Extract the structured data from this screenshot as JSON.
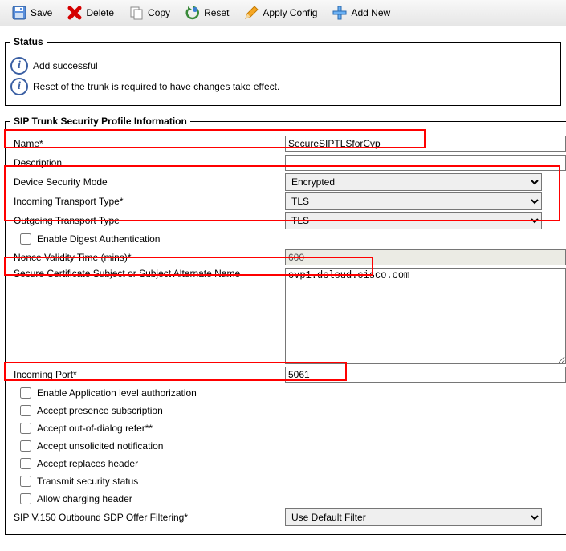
{
  "toolbar": {
    "save": "Save",
    "delete": "Delete",
    "copy": "Copy",
    "reset": "Reset",
    "apply": "Apply Config",
    "addnew": "Add New"
  },
  "status": {
    "legend": "Status",
    "line1": "Add successful",
    "line2": "Reset of the trunk is required to have changes take effect."
  },
  "profile": {
    "legend": "SIP Trunk Security Profile Information",
    "name_label": "Name*",
    "name_value": "SecureSIPTLSforCvp",
    "desc_label": "Description",
    "desc_value": "",
    "devmode_label": "Device Security Mode",
    "devmode_value": "Encrypted",
    "in_transport_label": "Incoming Transport Type*",
    "in_transport_value": "TLS",
    "out_transport_label": "Outgoing Transport Type",
    "out_transport_value": "TLS",
    "digest_label": "Enable Digest Authentication",
    "nonce_label": "Nonce Validity Time (mins)*",
    "nonce_value": "600",
    "cert_label": "Secure Certificate Subject or Subject Alternate Name",
    "cert_value": "cvp1.dcloud.cisco.com",
    "inport_label": "Incoming Port*",
    "inport_value": "5061",
    "appauth_label": "Enable Application level authorization",
    "presence_label": "Accept presence subscription",
    "refer_label": "Accept out-of-dialog refer**",
    "unsolicited_label": "Accept unsolicited notification",
    "replaces_label": "Accept replaces header",
    "transmit_label": "Transmit security status",
    "charging_label": "Allow charging header",
    "v150_label": "SIP V.150 Outbound SDP Offer Filtering*",
    "v150_value": "Use Default Filter"
  }
}
